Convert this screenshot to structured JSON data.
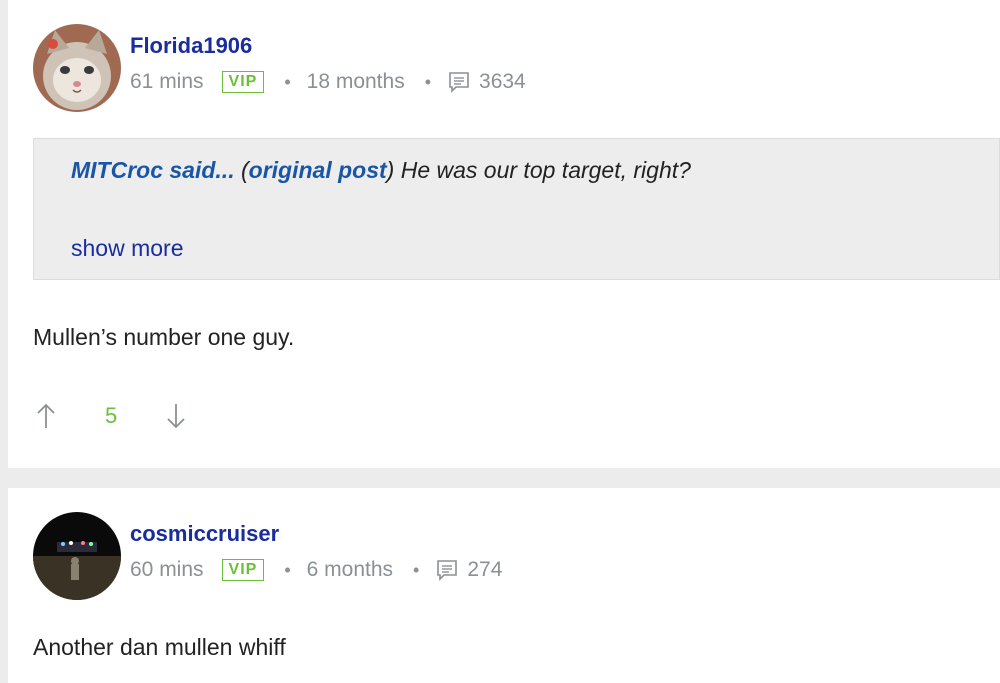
{
  "posts": [
    {
      "username": "Florida1906",
      "time": "61 mins",
      "badge": "VIP",
      "membership": "18 months",
      "comment_count": "3634",
      "quote": {
        "user": "MITCroc said...",
        "link_label": "original post",
        "text": "He was our top target, right?",
        "show_more": "show more"
      },
      "body": "Mullen’s number one guy.",
      "votes": "5"
    },
    {
      "username": "cosmiccruiser",
      "time": "60 mins",
      "badge": "VIP",
      "membership": "6 months",
      "comment_count": "274",
      "body": "Another dan mullen whiff"
    }
  ],
  "meta_separator": "•",
  "colors": {
    "username": "#1a2d9c",
    "quote_link": "#1a56a8",
    "vip": "#6cbf3a",
    "meta_gray": "#8a9094"
  },
  "icons": [
    "comment-icon",
    "upvote-arrow-icon",
    "downvote-arrow-icon"
  ]
}
